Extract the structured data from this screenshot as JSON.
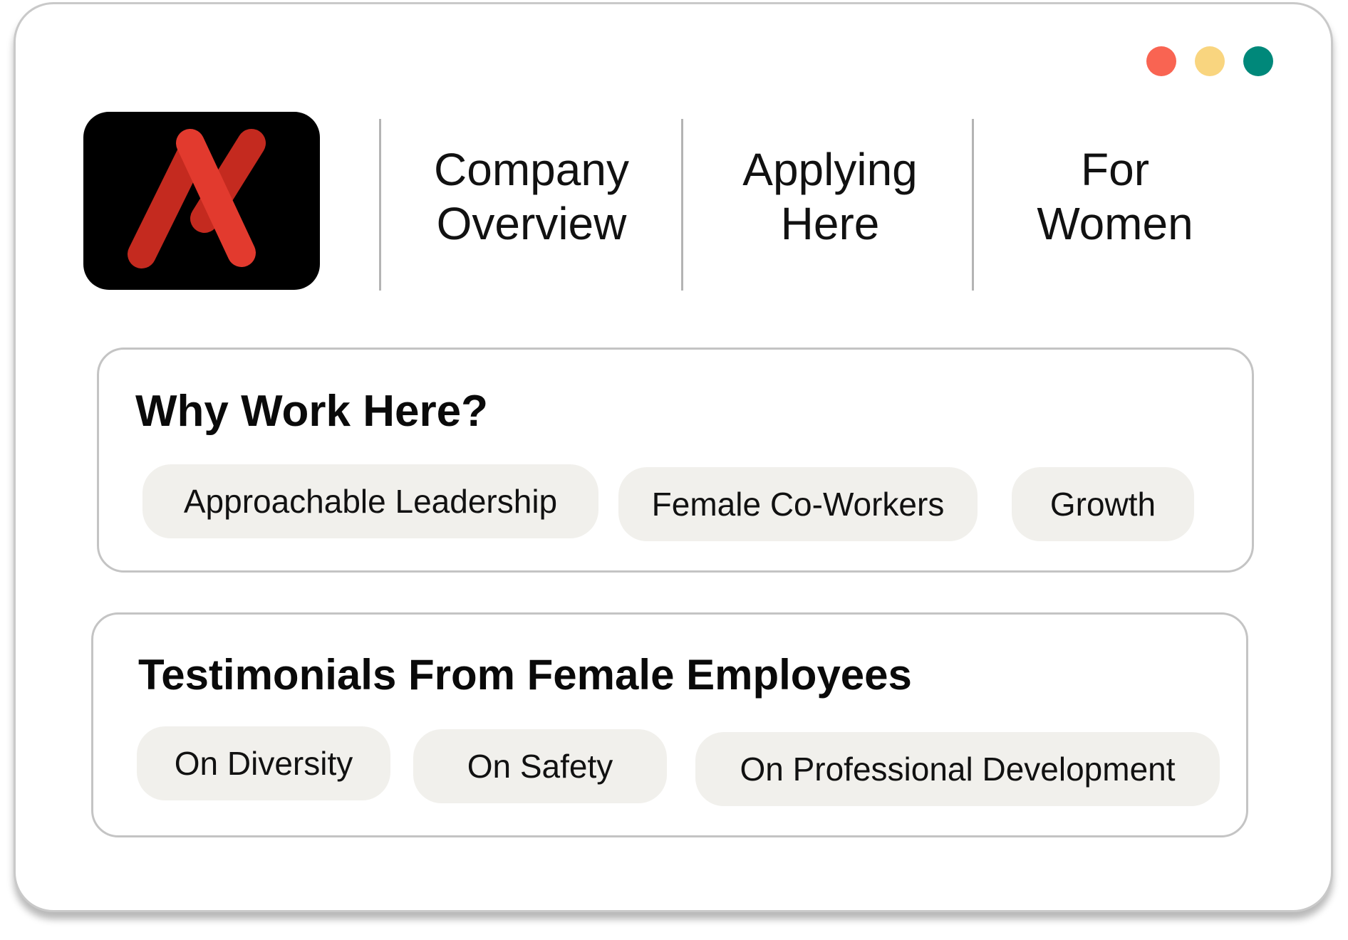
{
  "window": {
    "controls": [
      {
        "name": "close",
        "color": "#f96452"
      },
      {
        "name": "minimize",
        "color": "#f9d57f"
      },
      {
        "name": "maximize",
        "color": "#00887a"
      }
    ]
  },
  "logo": {
    "icon": "stylized-x-logo",
    "background": "#000000",
    "stroke_dark": "#c42a1f",
    "stroke_light": "#e23a2e"
  },
  "nav": {
    "items": [
      {
        "line1": "Company",
        "line2": "Overview"
      },
      {
        "line1": "Applying",
        "line2": "Here"
      },
      {
        "line1": "For",
        "line2": "Women"
      }
    ]
  },
  "why_work_here": {
    "title": "Why Work Here?",
    "chips": [
      "Approachable Leadership",
      "Female Co-Workers",
      "Growth"
    ]
  },
  "testimonials": {
    "title": "Testimonials From Female Employees",
    "chips": [
      "On Diversity",
      "On Safety",
      "On Professional Development"
    ]
  },
  "colors": {
    "chip_bg": "#f1f0ec",
    "border": "#c4c4c4"
  }
}
